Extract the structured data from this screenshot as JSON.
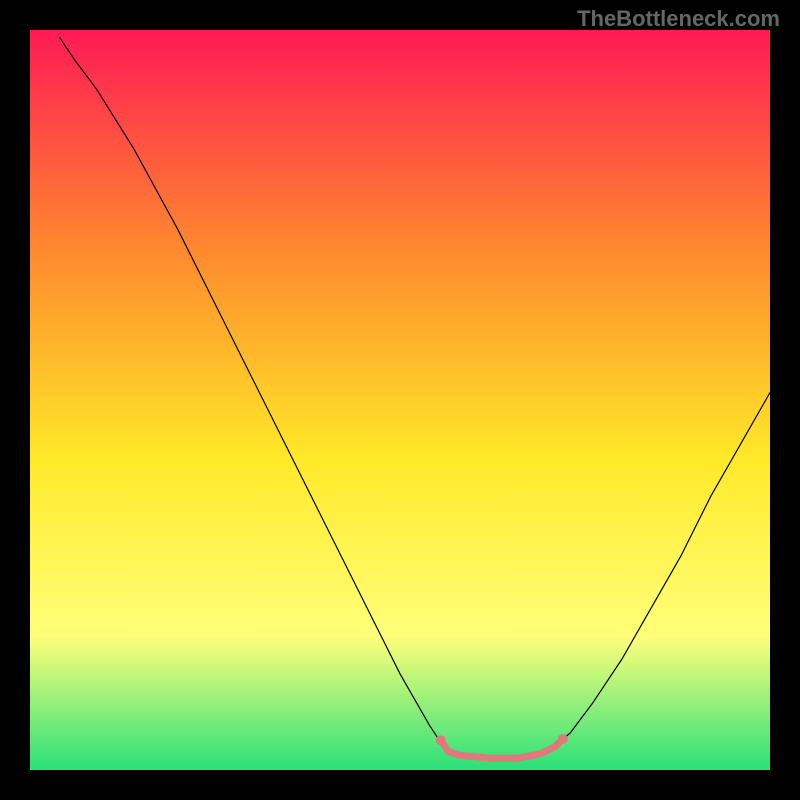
{
  "watermark": "TheBottleneck.com",
  "chart_data": {
    "type": "line",
    "title": "",
    "xlabel": "",
    "ylabel": "",
    "xlim": [
      0,
      100
    ],
    "ylim": [
      0,
      100
    ],
    "background_gradient": {
      "top": "#ff1a55",
      "mid1": "#ff8a2e",
      "mid2": "#ffe928",
      "mid3": "#ffff7a",
      "bottom": "#29e07a"
    },
    "series": [
      {
        "name": "curve",
        "color": "#000000",
        "stroke_width": 1.2,
        "points": [
          {
            "x": 4,
            "y": 99
          },
          {
            "x": 6,
            "y": 96
          },
          {
            "x": 9,
            "y": 92
          },
          {
            "x": 14,
            "y": 84
          },
          {
            "x": 20,
            "y": 73
          },
          {
            "x": 26,
            "y": 61
          },
          {
            "x": 32,
            "y": 49
          },
          {
            "x": 38,
            "y": 37
          },
          {
            "x": 44,
            "y": 25
          },
          {
            "x": 50,
            "y": 13
          },
          {
            "x": 54,
            "y": 6
          },
          {
            "x": 56,
            "y": 3
          },
          {
            "x": 58,
            "y": 2
          },
          {
            "x": 62,
            "y": 1.6
          },
          {
            "x": 66,
            "y": 1.6
          },
          {
            "x": 70,
            "y": 2.5
          },
          {
            "x": 73,
            "y": 5
          },
          {
            "x": 76,
            "y": 9
          },
          {
            "x": 80,
            "y": 15
          },
          {
            "x": 84,
            "y": 22
          },
          {
            "x": 88,
            "y": 29
          },
          {
            "x": 92,
            "y": 37
          },
          {
            "x": 96,
            "y": 44
          },
          {
            "x": 100,
            "y": 51
          }
        ]
      },
      {
        "name": "highlight",
        "color": "#e07a7a",
        "stroke_width": 7,
        "points": [
          {
            "x": 55.5,
            "y": 4.0
          },
          {
            "x": 56.5,
            "y": 2.5
          },
          {
            "x": 58,
            "y": 2.0
          },
          {
            "x": 62,
            "y": 1.6
          },
          {
            "x": 66,
            "y": 1.6
          },
          {
            "x": 69,
            "y": 2.2
          },
          {
            "x": 71,
            "y": 3.2
          },
          {
            "x": 72,
            "y": 4.2
          }
        ]
      }
    ],
    "highlight_dots": [
      {
        "x": 55.5,
        "y": 4.0
      },
      {
        "x": 72,
        "y": 4.2
      }
    ]
  }
}
